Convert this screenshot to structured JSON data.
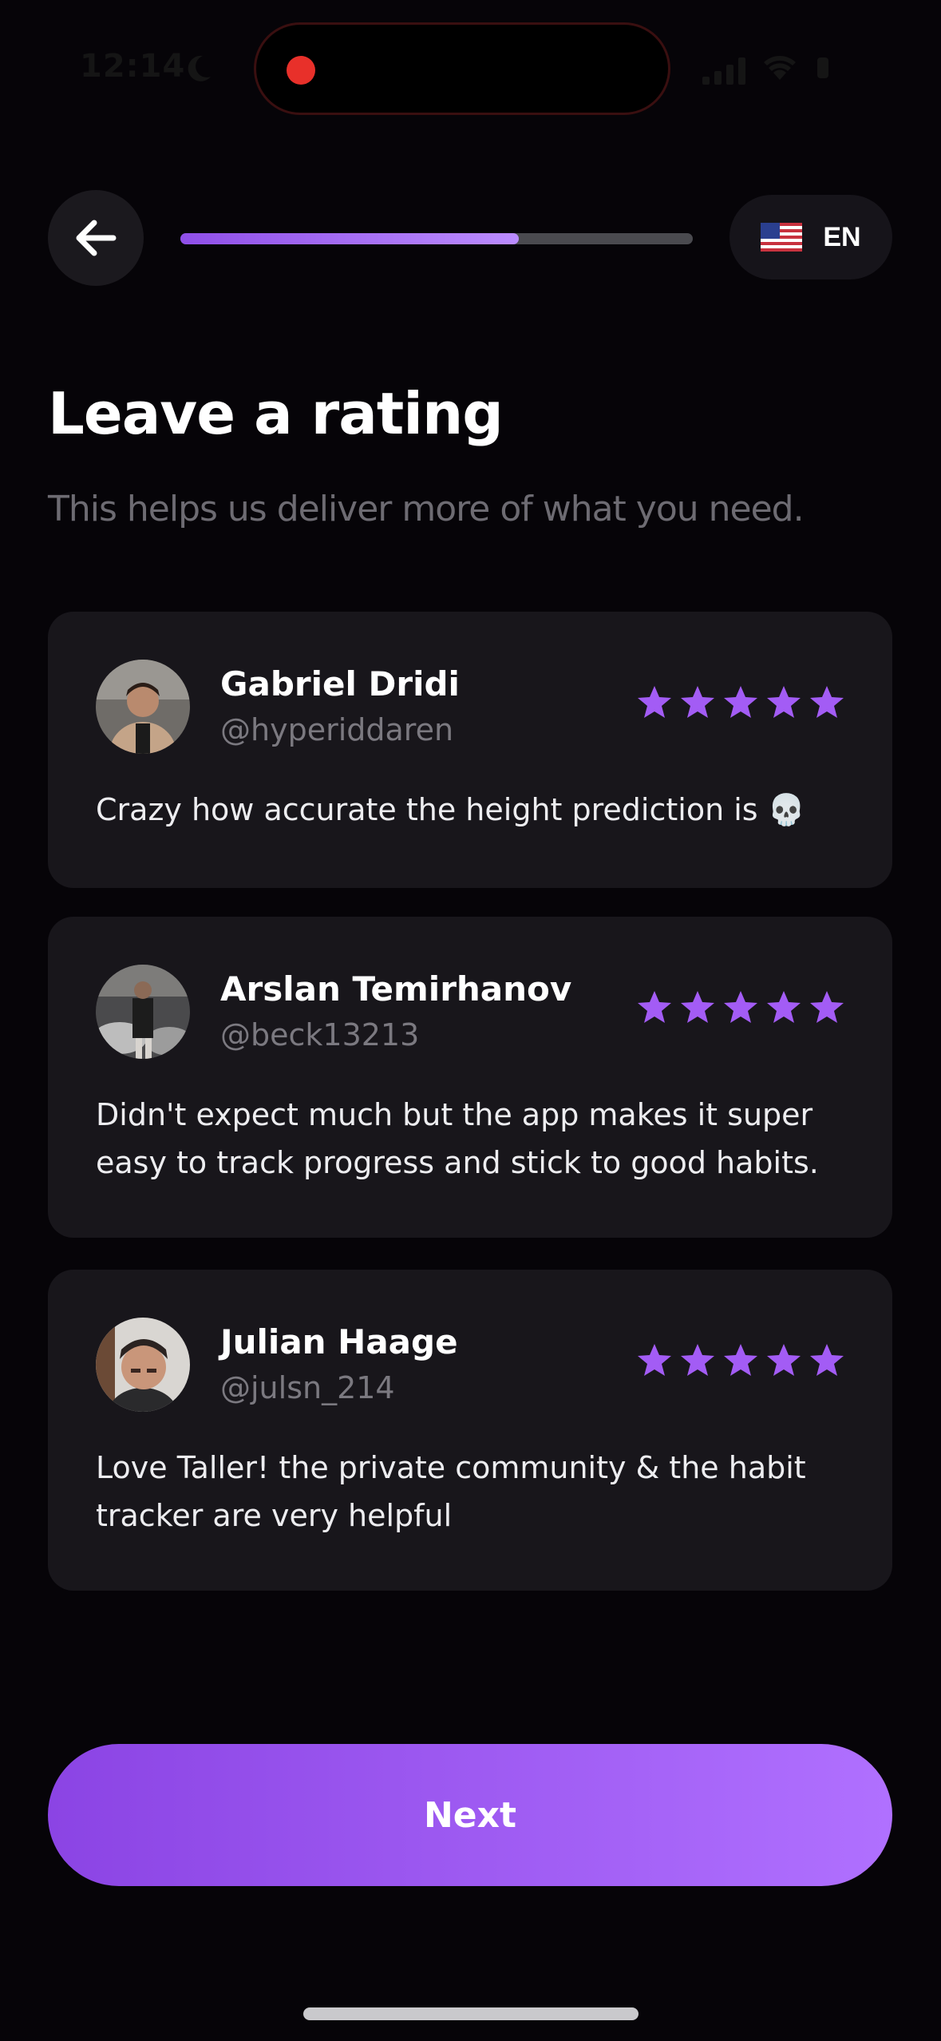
{
  "status_bar": {
    "time": "12:14",
    "icons": [
      "moon-icon",
      "signal-icon",
      "wifi-icon",
      "battery-icon"
    ],
    "recording_color": "#e8302a"
  },
  "header": {
    "back_icon": "arrow-left-icon",
    "progress_fraction": 0.66,
    "language": {
      "flag": "us-flag-icon",
      "label": "EN"
    }
  },
  "title": "Leave a rating",
  "subtitle": "This helps us deliver more of what you need.",
  "reviews": [
    {
      "name": "Gabriel Dridi",
      "handle": "@hyperiddaren",
      "rating": 5,
      "text": "Crazy how accurate the height prediction is 💀"
    },
    {
      "name": "Arslan Temirhanov",
      "handle": "@beck13213",
      "rating": 5,
      "text": "Didn't expect much but the app makes it super easy to track progress and stick to good habits."
    },
    {
      "name": "Julian Haage",
      "handle": "@julsn_214",
      "rating": 5,
      "text": "Love Taller! the private community & the habit tracker are very helpful"
    }
  ],
  "next_button": {
    "label": "Next"
  },
  "colors": {
    "accent": "#9b5cf0",
    "star": "#a35cf5",
    "background": "#060408",
    "card": "#18161b"
  }
}
